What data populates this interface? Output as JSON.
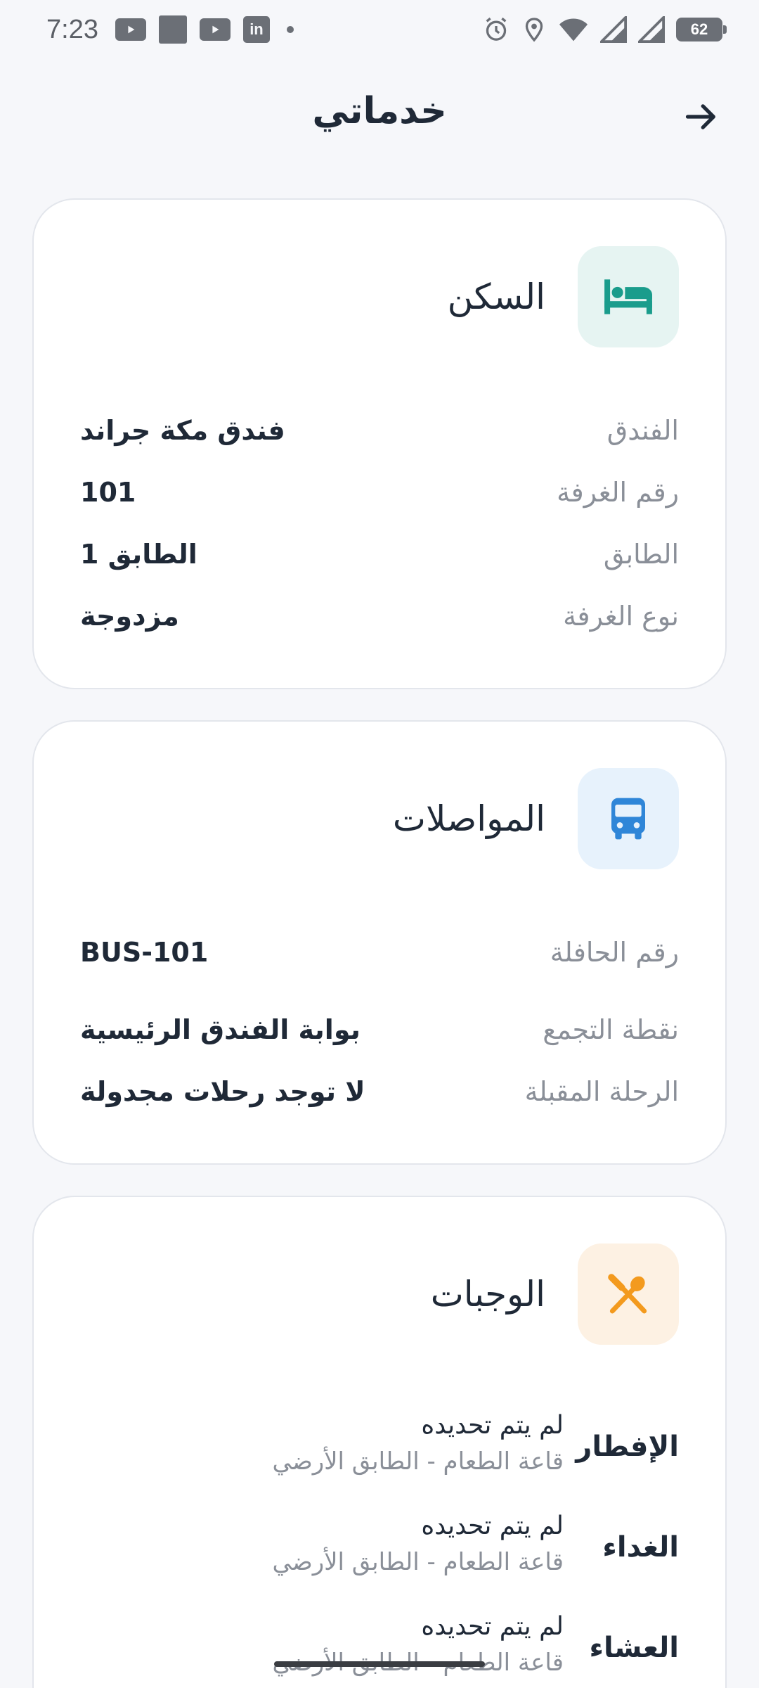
{
  "status_bar": {
    "time": "7:23",
    "battery": "62",
    "left_icons": [
      "youtube-icon",
      "app-square-icon",
      "youtube-icon",
      "linkedin-icon",
      "dot-icon"
    ],
    "right_icons": [
      "alarm-icon",
      "location-icon",
      "wifi-icon",
      "signal-icon",
      "signal-icon",
      "battery-icon"
    ],
    "linkedin_glyph": "in"
  },
  "header": {
    "title": "خدماتي",
    "back_icon": "arrow-right-icon"
  },
  "accommodation": {
    "title": "السكن",
    "icon": "bed-icon",
    "accent": "#1a9c8c",
    "tile_bg": "#e6f4f2",
    "rows": [
      {
        "label": "الفندق",
        "value": "فندق مكة جراند"
      },
      {
        "label": "رقم الغرفة",
        "value": "101"
      },
      {
        "label": "الطابق",
        "value": "الطابق 1"
      },
      {
        "label": "نوع الغرفة",
        "value": "مزدوجة"
      }
    ]
  },
  "transport": {
    "title": "المواصلات",
    "icon": "bus-icon",
    "accent": "#2f86d8",
    "tile_bg": "#e7f2fc",
    "rows": [
      {
        "label": "رقم الحافلة",
        "value": "BUS-101"
      },
      {
        "label": "نقطة التجمع",
        "value": "بوابة الفندق الرئيسية"
      },
      {
        "label": "الرحلة المقبلة",
        "value": "لا توجد رحلات مجدولة"
      }
    ]
  },
  "meals": {
    "title": "الوجبات",
    "icon": "utensils-icon",
    "accent": "#f39a1e",
    "tile_bg": "#fdf1e3",
    "items": [
      {
        "label": "الإفطار",
        "time": "لم يتم تحديده",
        "place": "قاعة الطعام - الطابق الأرضي"
      },
      {
        "label": "الغداء",
        "time": "لم يتم تحديده",
        "place": "قاعة الطعام - الطابق الأرضي"
      },
      {
        "label": "العشاء",
        "time": "لم يتم تحديده",
        "place": "قاعة الطعام - الطابق الأرضي"
      }
    ]
  }
}
